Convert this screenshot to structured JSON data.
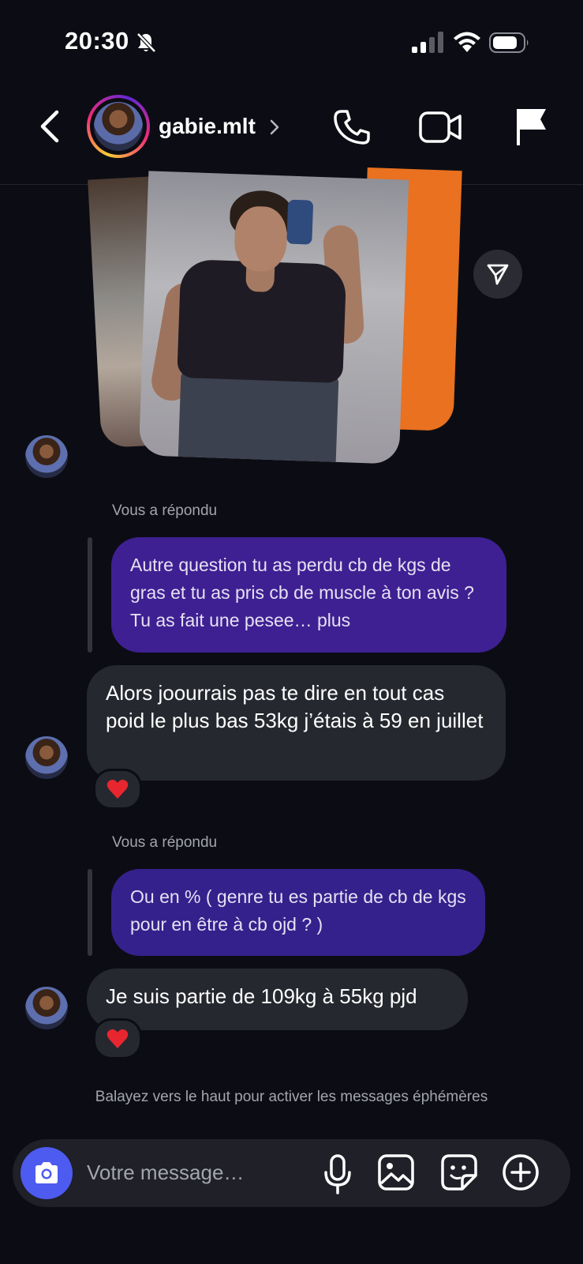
{
  "status_bar": {
    "time": "20:30",
    "icons": [
      "bell-slash-icon",
      "signal-icon",
      "wifi-icon",
      "battery-icon"
    ]
  },
  "header": {
    "username": "gabie.mlt",
    "icons": [
      "back-icon",
      "chevron-right-icon",
      "phone-icon",
      "video-icon",
      "flag-icon"
    ]
  },
  "messages": [
    {
      "type": "photo",
      "direction": "incoming"
    },
    {
      "type": "reply_label",
      "text": "Vous a répondu"
    },
    {
      "type": "outgoing",
      "text": "Autre question tu as perdu cb de kgs de gras et tu as pris cb de muscle à ton avis ? Tu as fait une pesee… plus"
    },
    {
      "type": "incoming",
      "text": "Alors joourrais pas te dire en tout cas poid le plus bas 53kg j’étais à 59 en juillet",
      "reaction": "❤️"
    },
    {
      "type": "reply_label",
      "text": "Vous a répondu"
    },
    {
      "type": "outgoing",
      "text": "Ou en % ( genre tu es partie de cb de kgs pour en être à cb ojd ? )"
    },
    {
      "type": "incoming",
      "text": "Je suis partie de 109kg à 55kg pjd",
      "reaction": "❤️"
    }
  ],
  "ephemeral_hint": "Balayez vers le haut pour activer les messages éphémères",
  "composer": {
    "placeholder": "Votre message…",
    "icons": [
      "camera-icon",
      "microphone-icon",
      "gallery-icon",
      "sticker-icon",
      "plus-circle-icon"
    ]
  },
  "colors": {
    "background": "#0c0d14",
    "outgoing_bubble": "#3e2092",
    "incoming_bubble": "#262830",
    "camera_button": "#4d5bf0"
  }
}
